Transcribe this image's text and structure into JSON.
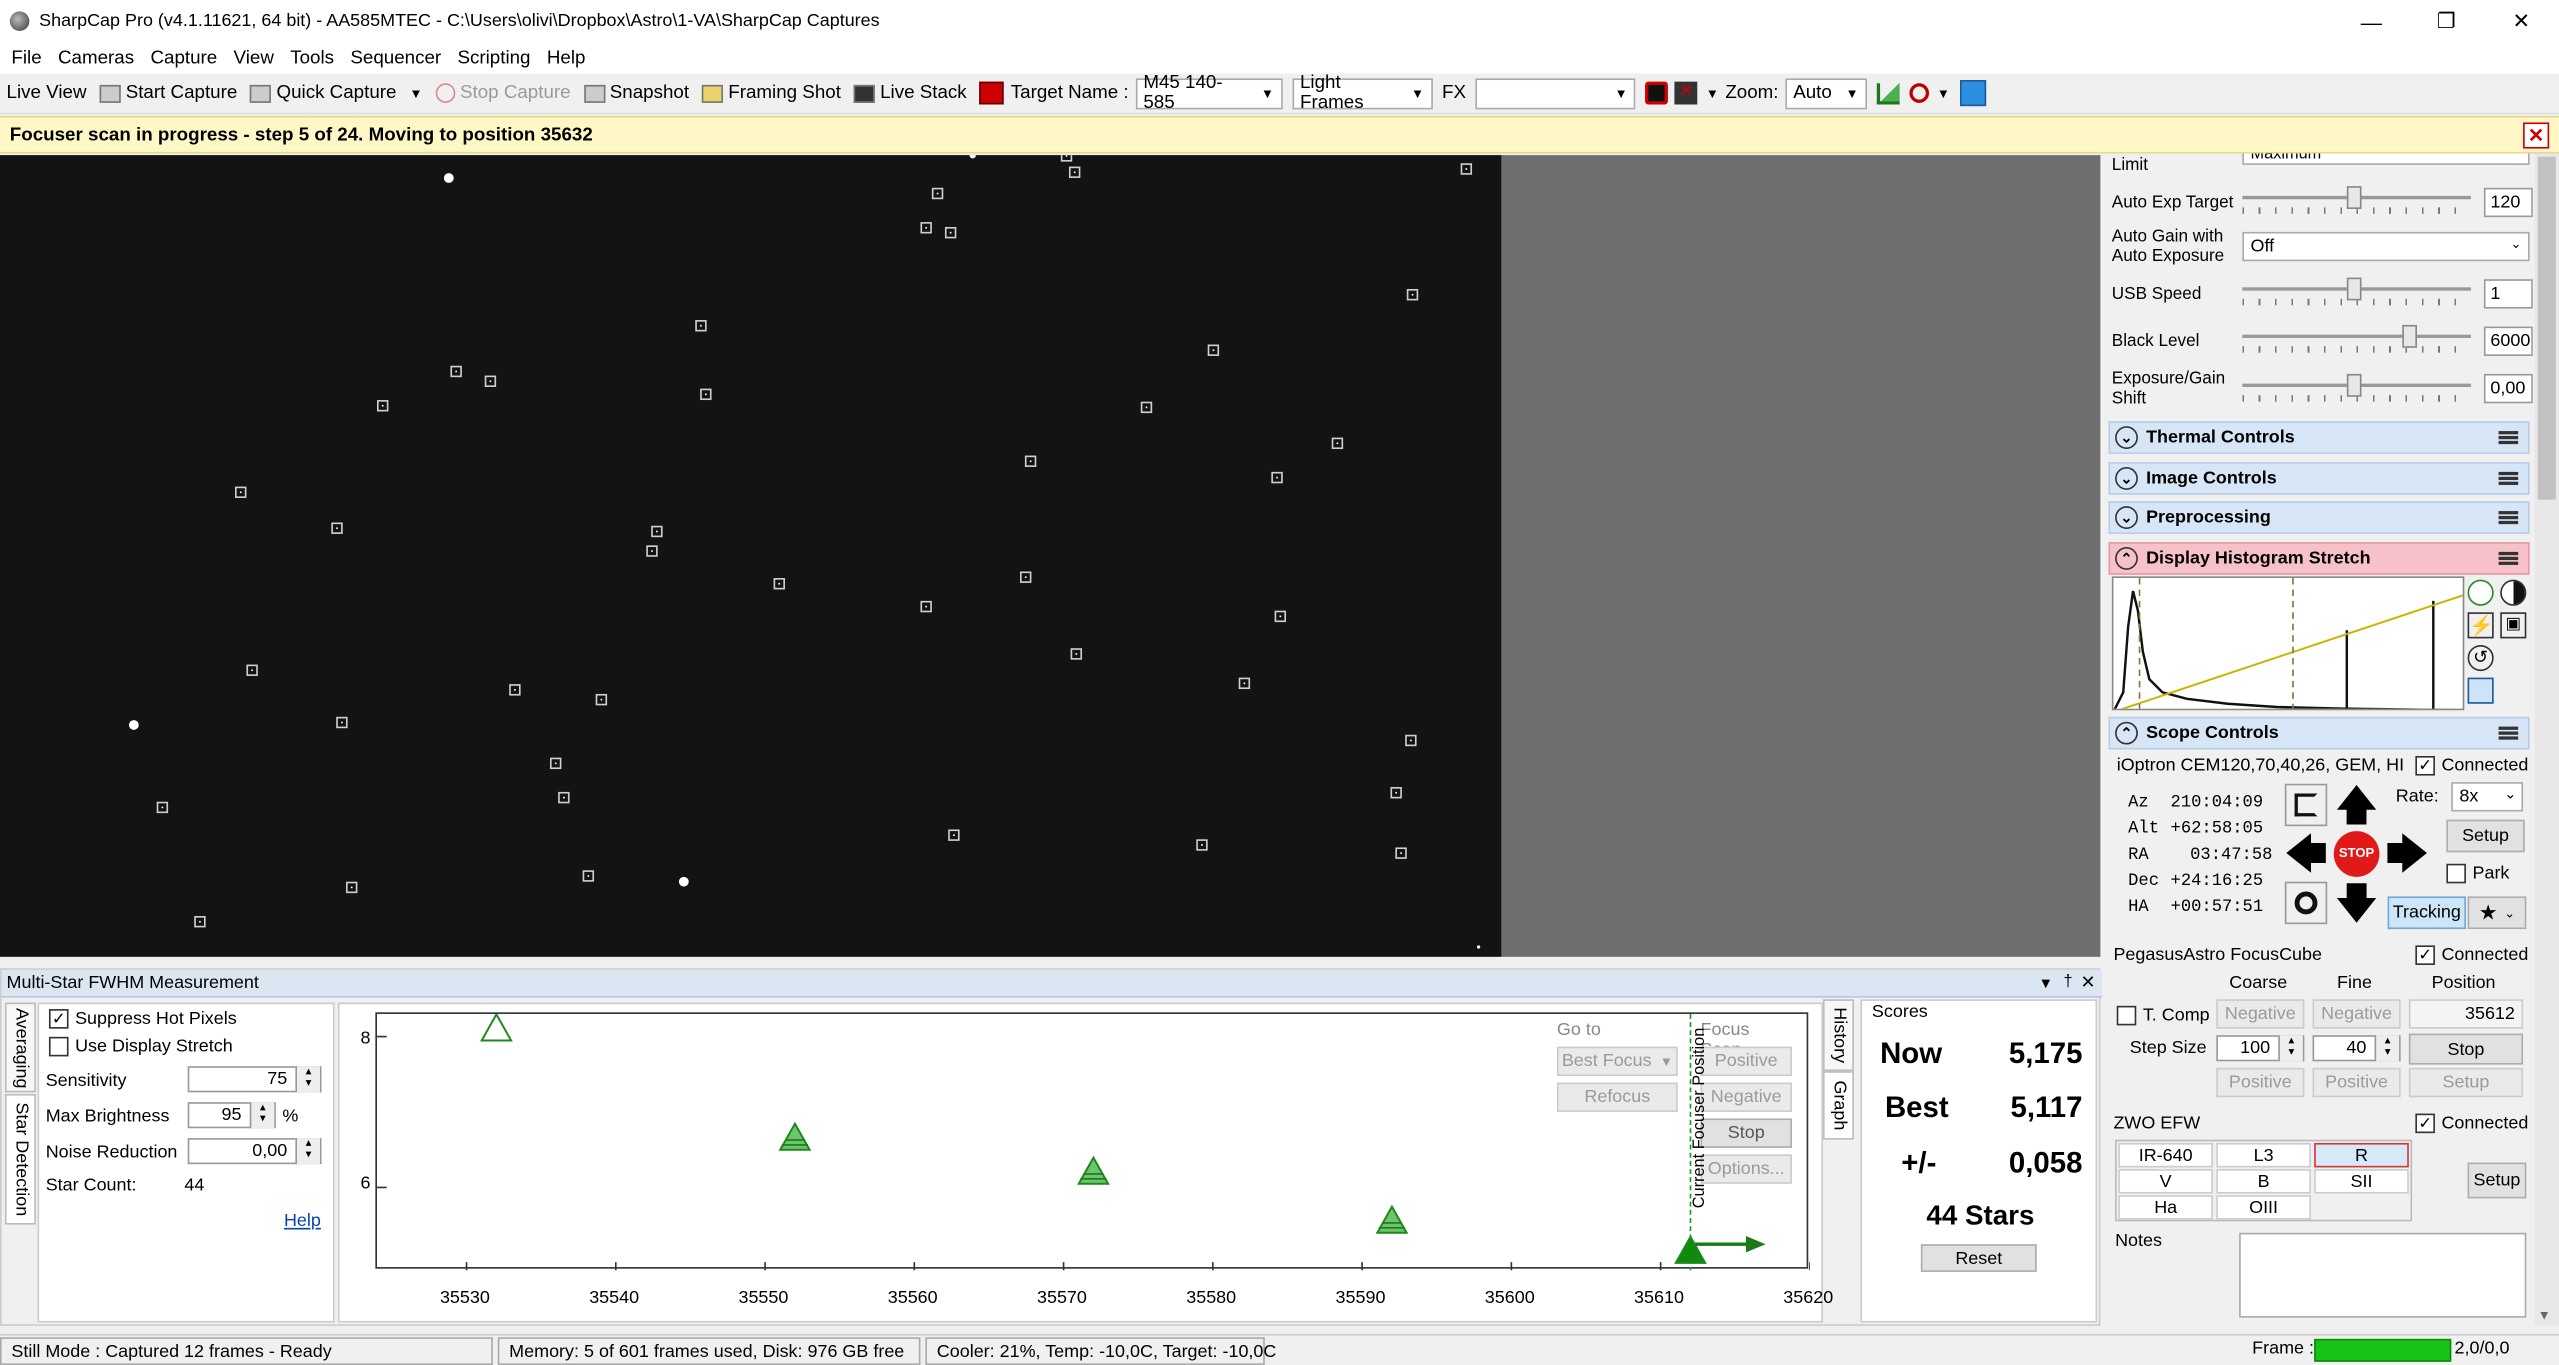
{
  "window": {
    "title": "SharpCap Pro (v4.1.11621, 64 bit) - AA585MTEC - C:\\Users\\olivi\\Dropbox\\Astro\\1-VA\\SharpCap Captures"
  },
  "menu": [
    "File",
    "Cameras",
    "Capture",
    "View",
    "Tools",
    "Sequencer",
    "Scripting",
    "Help"
  ],
  "toolbar": {
    "live_view": "Live View",
    "start_capture": "Start Capture",
    "quick_capture": "Quick Capture",
    "stop_capture": "Stop Capture",
    "snapshot": "Snapshot",
    "framing_shot": "Framing Shot",
    "live_stack": "Live Stack",
    "target_name_label": "Target Name :",
    "target_name": "M45 140-585",
    "frame_type": "Light Frames",
    "fx_label": "FX",
    "fx_value": "",
    "zoom_label": "Zoom:",
    "zoom_value": "Auto"
  },
  "notification": "Focuser scan in progress - step 5 of 24. Moving to position 35632",
  "camera_controls": {
    "limit_label": "Limit",
    "limit_value": "Maximum",
    "auto_exp_target_label": "Auto Exp Target",
    "auto_exp_target": "120",
    "auto_gain_label": "Auto Gain with Auto Exposure",
    "auto_gain_value": "Off",
    "usb_speed_label": "USB Speed",
    "usb_speed": "1",
    "black_level_label": "Black Level",
    "black_level": "6000",
    "exp_gain_shift_label": "Exposure/Gain Shift",
    "exp_gain_shift": "0,00"
  },
  "sections": {
    "thermal": "Thermal Controls",
    "image": "Image Controls",
    "preprocessing": "Preprocessing",
    "histogram": "Display Histogram Stretch",
    "scope": "Scope Controls"
  },
  "scope": {
    "mount": "iOptron CEM120,70,40,26, GEM, HI",
    "connected": "Connected",
    "az_label": "Az",
    "az": "210:04:09",
    "alt_label": "Alt",
    "alt": "+62:58:05",
    "ra_label": "RA",
    "ra": "03:47:58",
    "dec_label": "Dec",
    "dec": "+24:16:25",
    "ha_label": "HA",
    "ha": "+00:57:51",
    "rate_label": "Rate:",
    "rate": "8x",
    "setup": "Setup",
    "park": "Park",
    "tracking": "Tracking",
    "stop": "STOP"
  },
  "focuser": {
    "name": "PegasusAstro FocusCube",
    "connected": "Connected",
    "coarse": "Coarse",
    "fine": "Fine",
    "position_label": "Position",
    "t_comp": "T. Comp",
    "negative": "Negative",
    "position": "35612",
    "step_size_label": "Step Size",
    "coarse_step": "100",
    "fine_step": "40",
    "stop": "Stop",
    "positive": "Positive",
    "setup": "Setup"
  },
  "efw": {
    "name": "ZWO EFW",
    "connected": "Connected",
    "filters": [
      "IR-640",
      "L3",
      "R",
      "V",
      "B",
      "SII",
      "Ha",
      "OIII"
    ],
    "selected": "R",
    "setup": "Setup"
  },
  "notes_label": "Notes",
  "fwhm": {
    "title": "Multi-Star FWHM Measurement",
    "tab_averaging": "Averaging",
    "tab_star_detection": "Star Detection",
    "suppress_hot_pixels": "Suppress Hot Pixels",
    "use_display_stretch": "Use Display Stretch",
    "sensitivity_label": "Sensitivity",
    "sensitivity": "75",
    "max_brightness_label": "Max Brightness",
    "max_brightness": "95",
    "percent": "%",
    "noise_reduction_label": "Noise Reduction",
    "noise_reduction": "0,00",
    "star_count_label": "Star Count:",
    "star_count": "44",
    "help": "Help",
    "goto_label": "Go to",
    "best_focus": "Best Focus",
    "refocus": "Refocus",
    "focus_scan_label": "Focus Scan",
    "positive": "Positive",
    "negative": "Negative",
    "stop": "Stop",
    "options": "Options...",
    "current_focuser_position": "Current Focuser Position",
    "tab_history": "History",
    "tab_graph": "Graph",
    "scores_label": "Scores",
    "now_label": "Now",
    "now": "5,175",
    "best_label": "Best",
    "best": "5,117",
    "pm_label": "+/-",
    "pm": "0,058",
    "stars": "44 Stars",
    "reset": "Reset"
  },
  "chart_data": {
    "type": "scatter",
    "x": [
      35532,
      35552,
      35572,
      35592,
      35612
    ],
    "y": [
      8.1,
      6.65,
      6.2,
      5.55,
      5.15
    ],
    "xlim": [
      35524,
      35620
    ],
    "ylim": [
      4.9,
      8.3
    ],
    "xticks": [
      35530,
      35540,
      35550,
      35560,
      35570,
      35580,
      35590,
      35600,
      35610,
      35620
    ],
    "yticks": [
      6,
      8
    ],
    "current_position": 35612
  },
  "status": {
    "mode": "Still Mode : Captured 12 frames - Ready",
    "memory": "Memory: 5 of 601 frames used, Disk: 976 GB free",
    "cooler": "Cooler: 21%, Temp: -10,0C, Target: -10,0C",
    "frame_label": "Frame :",
    "frame_value": "2,0/0,0"
  },
  "colors": {
    "accent": "#1e6fd9",
    "notify": "#fff8c6",
    "marker": "#1a9a1a",
    "selected_filter": "#d6e9f8",
    "frame_bar": "#17c317"
  }
}
